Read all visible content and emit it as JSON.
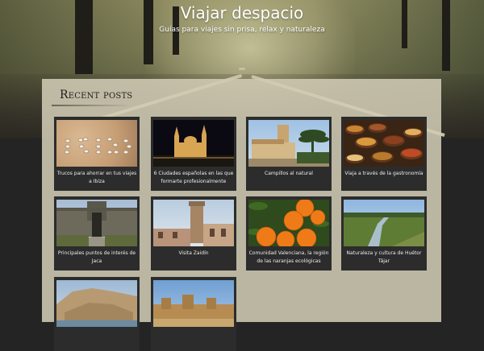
{
  "site": {
    "title": "Viajar despacio",
    "tagline": "Guías para viajes sin prisa, relax y naturaleza"
  },
  "section": {
    "title": "Recent posts"
  },
  "posts": [
    {
      "label": "Trucos para ahorrar en tus viajes a Ibiza"
    },
    {
      "label": "6 Ciudades españolas en las que formarte profesionalmente"
    },
    {
      "label": "Campillos al natural"
    },
    {
      "label": "Viaja a través de la gastronomía"
    },
    {
      "label": "Principales puntos de interés de Jaca"
    },
    {
      "label": "Visita Zaidín"
    },
    {
      "label": "Comunidad Valenciana, la región de las naranjas ecológicas"
    },
    {
      "label": "Naturaleza y cultura de Huétor Tájar"
    },
    {
      "label": ""
    },
    {
      "label": ""
    }
  ]
}
